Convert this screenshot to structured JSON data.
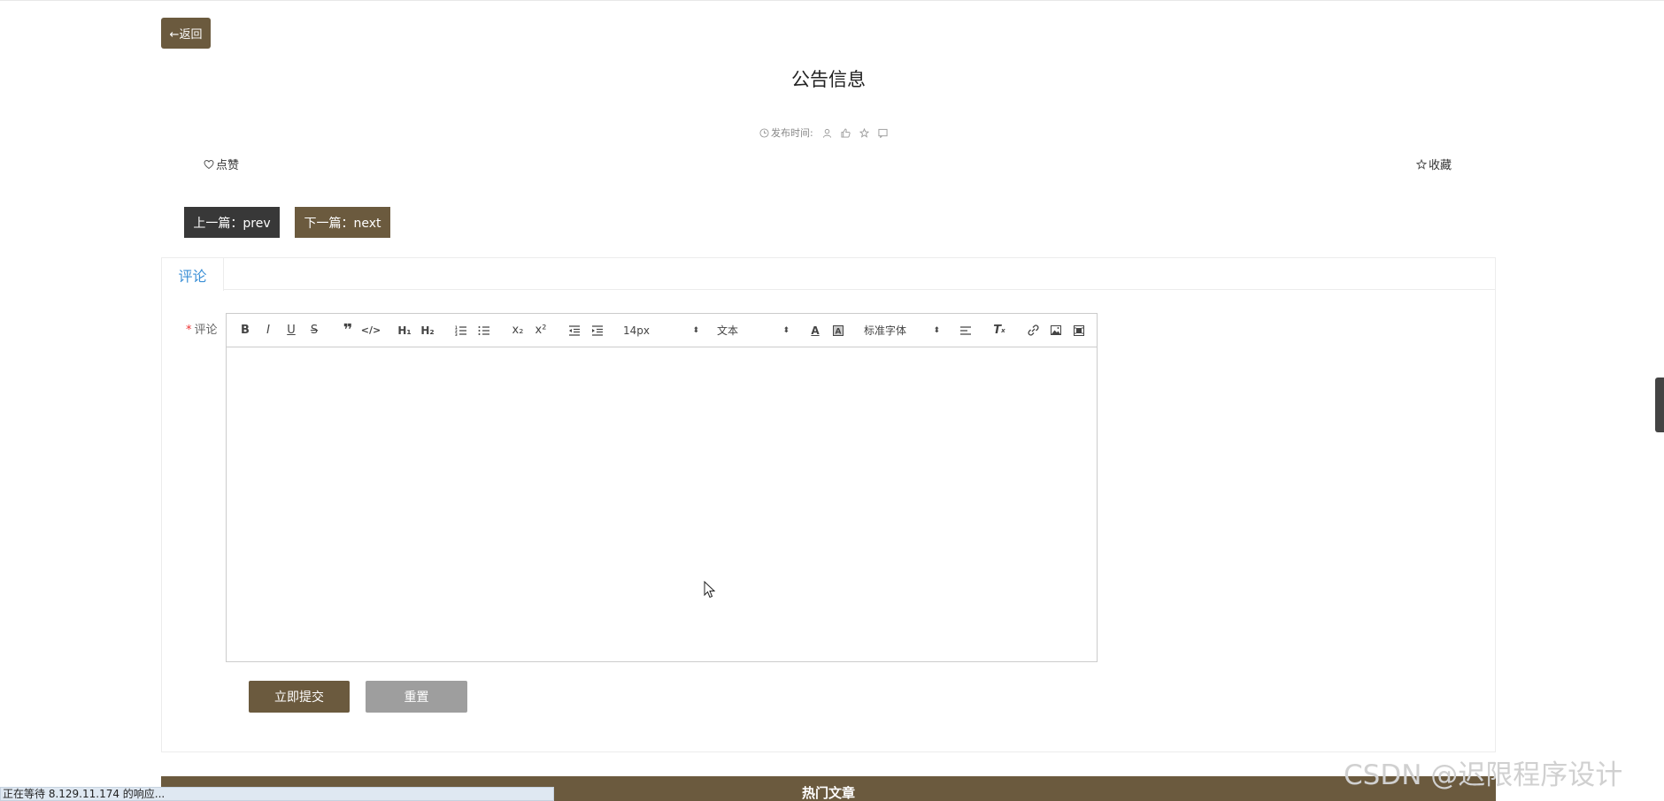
{
  "nav": {
    "back_label": "←返回"
  },
  "article": {
    "title": "公告信息",
    "meta": {
      "publish_label": "发布时间:"
    }
  },
  "actions": {
    "like_label": "点赞",
    "favorite_label": "收藏"
  },
  "pager": {
    "prev_label": "上一篇：prev",
    "next_label": "下一篇：next"
  },
  "comments": {
    "tab_label": "评论",
    "field_label": "评论",
    "toolbar": {
      "font_size": "14px",
      "header": "文本",
      "font_family": "标准字体"
    },
    "submit_label": "立即提交",
    "reset_label": "重置"
  },
  "hot_articles": {
    "title": "热门文章"
  },
  "browser": {
    "status_text": "正在等待 8.129.11.174 的响应..."
  },
  "watermark": "CSDN @迟限程序设计",
  "colors": {
    "brand": "#6b5a3e",
    "dark_button": "#383838",
    "tab_active": "#3a8fd6",
    "reset_button": "#9e9e9e"
  }
}
